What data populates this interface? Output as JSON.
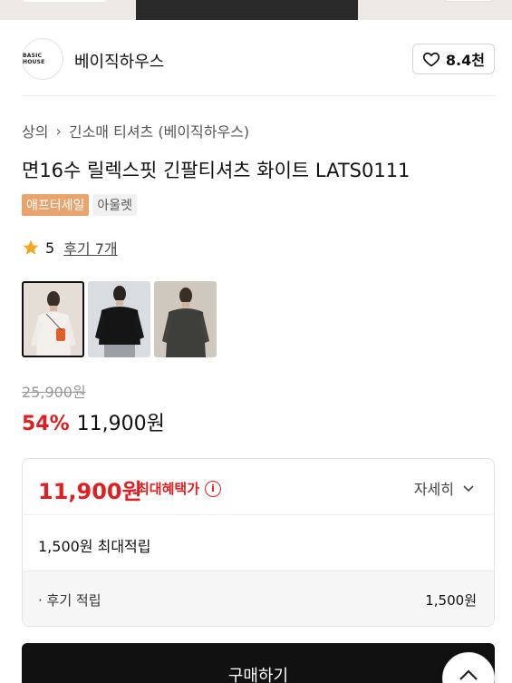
{
  "brand": {
    "logo_text": "BASIC HOUSE",
    "name": "베이직하우스",
    "like_count": "8.4천"
  },
  "breadcrumb": {
    "category": "상의",
    "subcategory": "긴소매 티셔츠 (베이직하우스)"
  },
  "product": {
    "title": "면16수 릴렉스핏 긴팔티셔츠 화이트 LATS0111",
    "badges": [
      "애프터세일",
      "아울렛"
    ],
    "rating": "5",
    "reviews_label": "후기 7개",
    "thumbnails": [
      "white-shirt-thumb",
      "black-shirt-thumb",
      "charcoal-shirt-thumb"
    ]
  },
  "price": {
    "original": "25,900원",
    "discount_pct": "54%",
    "sale": "11,900원"
  },
  "benefit": {
    "max_price": "11,900원",
    "max_label": "최대혜택가",
    "detail_label": "자세히",
    "points_summary": "1,500원 최대적립",
    "review_points_label": "· 후기 적립",
    "review_points_value": "1,500원"
  },
  "actions": {
    "buy_label": "구매하기"
  },
  "colors": {
    "accent_red": "#e02020",
    "badge_orange": "#e9a46d",
    "button_black": "#111111",
    "star_gold": "#f5a623"
  }
}
